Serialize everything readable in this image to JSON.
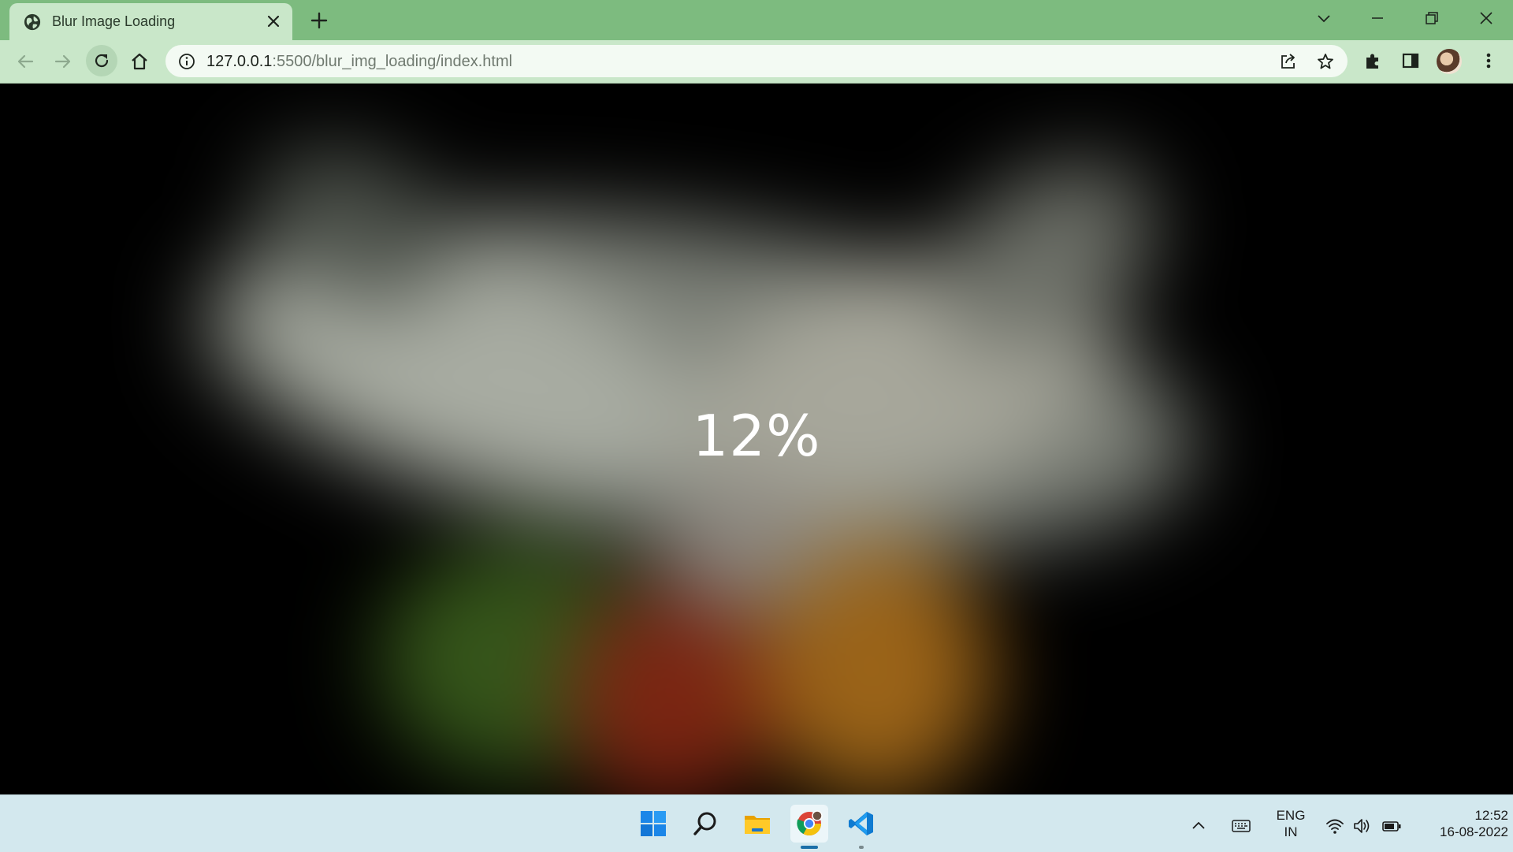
{
  "browser": {
    "tab": {
      "title": "Blur Image Loading",
      "favicon": "globe-icon"
    },
    "address": {
      "host": "127.0.0.1",
      "path": ":5500/blur_img_loading/index.html"
    }
  },
  "page": {
    "loading": {
      "percent": 12,
      "label": "12%"
    }
  },
  "taskbar": {
    "apps": [
      "windows-start",
      "search",
      "file-explorer",
      "chrome",
      "vscode"
    ],
    "active_app": "chrome",
    "language": {
      "line1": "ENG",
      "line2": "IN"
    },
    "clock": {
      "time": "12:52",
      "date": "16-08-2022"
    }
  },
  "colors": {
    "tab_strip": "#7dbb7f",
    "active_tab": "#c9e7c9",
    "omnibox": "#f3faf3",
    "taskbar": "#d3e8ee",
    "page_background": "#000000"
  }
}
